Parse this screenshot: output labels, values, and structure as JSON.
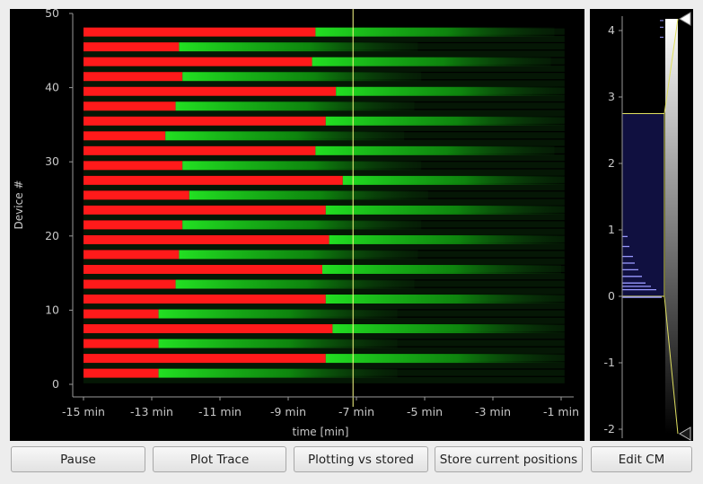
{
  "main_plot": {
    "xlabel": "time [min]",
    "ylabel": "Device #",
    "x_ticks": [
      "-15 min",
      "-13 min",
      "-11 min",
      "-9 min",
      "-7 min",
      "-5 min",
      "-3 min",
      "-1 min"
    ],
    "y_ticks": [
      "0",
      "10",
      "20",
      "30",
      "40",
      "50"
    ],
    "cursor_time_min": -7.1,
    "colors": {
      "background": "#000000",
      "red": "#ff1a1a",
      "green": "#22e022",
      "cursor": "#ffff88",
      "text": "#c8c8c8"
    }
  },
  "colormap_plot": {
    "y_ticks": [
      "4",
      "3",
      "2",
      "1",
      "0",
      "-1",
      "-2"
    ],
    "colors": {
      "histogram": "#9999ff",
      "box_fill": "#101040",
      "box_edge": "#e0e060"
    }
  },
  "chart_data": {
    "type": "heatmap",
    "xlabel": "time [min]",
    "ylabel": "Device #",
    "xlim": [
      -15.3,
      0.5
    ],
    "ylim": [
      -1,
      50
    ],
    "bars": [
      {
        "device": 47.5,
        "red_end_min": -8.2
      },
      {
        "device": 45.5,
        "red_end_min": -12.2
      },
      {
        "device": 43.5,
        "red_end_min": -8.3
      },
      {
        "device": 41.5,
        "red_end_min": -12.1
      },
      {
        "device": 39.5,
        "red_end_min": -7.6
      },
      {
        "device": 37.5,
        "red_end_min": -12.3
      },
      {
        "device": 35.5,
        "red_end_min": -7.9
      },
      {
        "device": 33.5,
        "red_end_min": -12.6
      },
      {
        "device": 31.5,
        "red_end_min": -8.2
      },
      {
        "device": 29.5,
        "red_end_min": -12.1
      },
      {
        "device": 27.5,
        "red_end_min": -7.4
      },
      {
        "device": 25.5,
        "red_end_min": -11.9
      },
      {
        "device": 23.5,
        "red_end_min": -7.9
      },
      {
        "device": 21.5,
        "red_end_min": -12.1
      },
      {
        "device": 19.5,
        "red_end_min": -7.8
      },
      {
        "device": 17.5,
        "red_end_min": -12.2
      },
      {
        "device": 15.5,
        "red_end_min": -8.0
      },
      {
        "device": 13.5,
        "red_end_min": -12.3
      },
      {
        "device": 11.5,
        "red_end_min": -7.9
      },
      {
        "device": 9.5,
        "red_end_min": -12.8
      },
      {
        "device": 7.5,
        "red_end_min": -7.7
      },
      {
        "device": 5.5,
        "red_end_min": -12.8
      },
      {
        "device": 3.5,
        "red_end_min": -7.9
      },
      {
        "device": 1.5,
        "red_end_min": -12.8
      }
    ],
    "colormap": {
      "ylim": [
        -2.1,
        4.2
      ],
      "box_range": [
        0,
        2.75
      ],
      "histogram": [
        {
          "y": 0.1,
          "v": 0.95
        },
        {
          "y": 0.15,
          "v": 0.8
        },
        {
          "y": 0.2,
          "v": 0.65
        },
        {
          "y": 0.3,
          "v": 0.55
        },
        {
          "y": 0.4,
          "v": 0.45
        },
        {
          "y": 0.5,
          "v": 0.35
        },
        {
          "y": 0.6,
          "v": 0.3
        },
        {
          "y": 0.75,
          "v": 0.2
        },
        {
          "y": 0.9,
          "v": 0.15
        }
      ]
    }
  },
  "buttons": {
    "pause": "Pause",
    "plot_trace": "Plot Trace",
    "plotting_vs_stored": "Plotting vs stored",
    "store_positions": "Store current positions",
    "edit_cm": "Edit CM"
  }
}
